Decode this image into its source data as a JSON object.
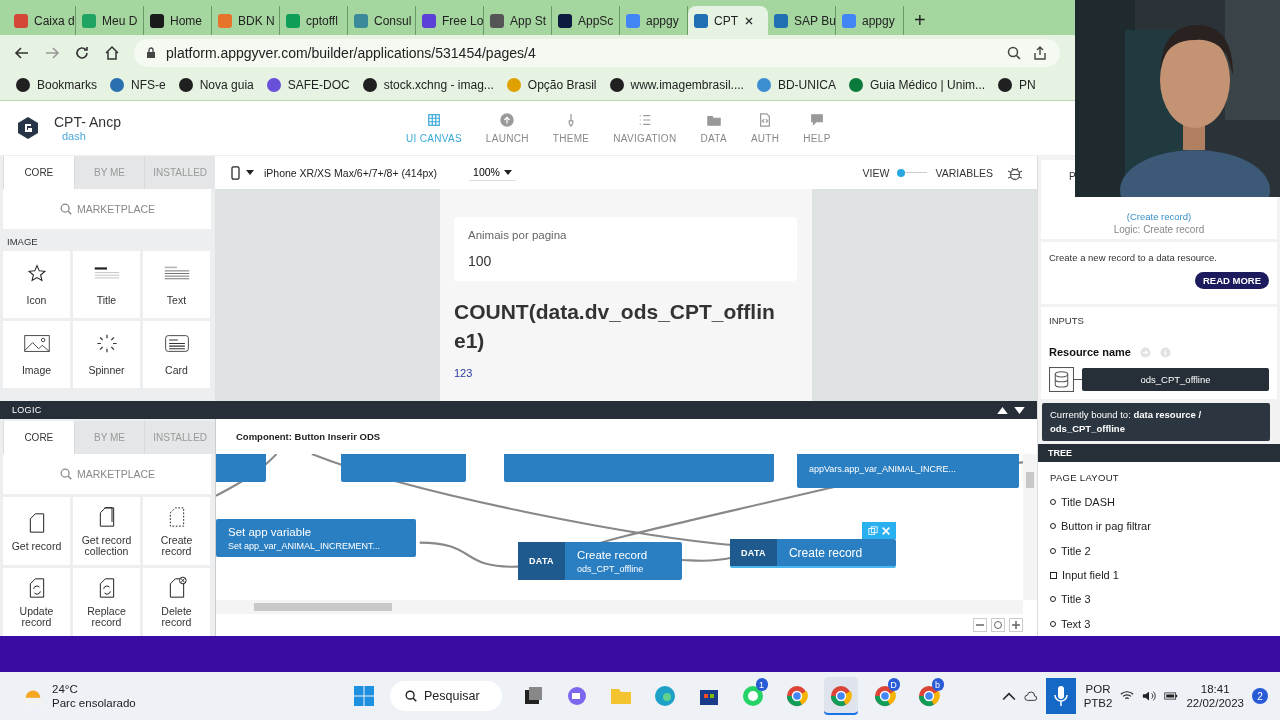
{
  "browser": {
    "tabs": [
      {
        "label": "Caixa d",
        "selected": false,
        "color": "#d44638"
      },
      {
        "label": "Meu D",
        "selected": false,
        "color": "#1fa463"
      },
      {
        "label": "Home",
        "selected": false,
        "color": "#1a1a1a"
      },
      {
        "label": "BDK N",
        "selected": false,
        "color": "#e8742a"
      },
      {
        "label": "cptoffl",
        "selected": false,
        "color": "#0f9d58"
      },
      {
        "label": "Consul",
        "selected": false,
        "color": "#3a8a9a"
      },
      {
        "label": "Free Lo",
        "selected": false,
        "color": "#5b3fd6"
      },
      {
        "label": "App St",
        "selected": false,
        "color": "#555555"
      },
      {
        "label": "AppSc",
        "selected": false,
        "color": "#0d1b3e"
      },
      {
        "label": "appgy",
        "selected": false,
        "color": "#4285f4"
      },
      {
        "label": "CPT",
        "selected": true,
        "color": "#1f6fb2"
      },
      {
        "label": "SAP Bu",
        "selected": false,
        "color": "#1f6fb2"
      },
      {
        "label": "appgy",
        "selected": false,
        "color": "#4285f4"
      }
    ],
    "new_tab": "+",
    "address": "platform.appgyver.com/builder/applications/531454/pages/4",
    "bookmarks": [
      {
        "label": "Bookmarks",
        "color": "#202020"
      },
      {
        "label": "NFS-e",
        "color": "#2a6fb0"
      },
      {
        "label": "Nova guia",
        "color": "#202020"
      },
      {
        "label": "SAFE-DOC",
        "color": "#6a4fd8"
      },
      {
        "label": "stock.xchng - imag...",
        "color": "#202020"
      },
      {
        "label": "Opção Brasil",
        "color": "#e0a000"
      },
      {
        "label": "www.imagembrasil....",
        "color": "#202020"
      },
      {
        "label": "BD-UNICA",
        "color": "#3b8fd0"
      },
      {
        "label": "Guia Médico | Unim...",
        "color": "#0a7a3a"
      },
      {
        "label": "PN",
        "color": "#202020"
      }
    ]
  },
  "app": {
    "title": "CPT- Ancp",
    "breadcrumb": "dash",
    "nav": [
      {
        "label": "UI CANVAS",
        "kind": "grid",
        "selected": true
      },
      {
        "label": "LAUNCH",
        "kind": "upload",
        "selected": false
      },
      {
        "label": "THEME",
        "kind": "brush",
        "selected": false
      },
      {
        "label": "NAVIGATION",
        "kind": "list",
        "selected": false
      },
      {
        "label": "DATA",
        "kind": "folder",
        "selected": false
      },
      {
        "label": "AUTH",
        "kind": "code",
        "selected": false
      },
      {
        "label": "HELP",
        "kind": "chat",
        "selected": false
      }
    ]
  },
  "palette": {
    "tabs": [
      {
        "label": "CORE",
        "selected": true
      },
      {
        "label": "BY ME",
        "selected": false
      },
      {
        "label": "INSTALLED",
        "selected": false
      }
    ],
    "search_placeholder": "MARKETPLACE",
    "section": "IMAGE",
    "items": [
      {
        "label": "Icon",
        "kind": "star"
      },
      {
        "label": "Title",
        "kind": "title"
      },
      {
        "label": "Text",
        "kind": "text"
      },
      {
        "label": "Image"
      },
      {
        "label": "Spinner",
        "kind": "spinner"
      },
      {
        "label": "Card",
        "kind": "card"
      }
    ]
  },
  "canvas": {
    "device": "iPhone XR/XS Max/6+/7+/8+ (414px)",
    "zoom": "100%",
    "view_label": "VIEW",
    "variables_label": "VARIABLES"
  },
  "preview": {
    "field_label": "Animais por pagina",
    "field_value": "100",
    "heading": "COUNT(data.dv_ods_CPT_offline1)",
    "number": "123"
  },
  "logic": {
    "title": "LOGIC",
    "palette": {
      "tabs": [
        {
          "label": "CORE",
          "selected": true
        },
        {
          "label": "BY ME",
          "selected": false
        },
        {
          "label": "INSTALLED",
          "selected": false
        }
      ],
      "search_placeholder": "MARKETPLACE",
      "items": [
        {
          "label": "Get record",
          "kind": "doc"
        },
        {
          "label": "Get record collection",
          "kind": "docs"
        },
        {
          "label": "Create record",
          "kind": "dashed"
        },
        {
          "label": "Update record",
          "kind": "refresh"
        },
        {
          "label": "Replace record",
          "kind": "refresh"
        },
        {
          "label": "Delete record",
          "kind": "delete"
        }
      ]
    },
    "component": "Component: Button Inserir ODS",
    "nodes": [
      {
        "kind": "stub",
        "selected": false
      },
      {
        "kind": "stub",
        "selected": false
      },
      {
        "kind": "stub",
        "selected": false
      },
      {
        "kind": "plain",
        "subtitle": "appVars.app_var_ANIMAL_INCRE...",
        "selected": false
      },
      {
        "kind": "plain",
        "title": "Set app variable",
        "subtitle": "Set app_var_ANIMAL_INCREMENT...",
        "selected": false
      },
      {
        "kind": "tagged",
        "category": "DATA",
        "title": "Create record",
        "subtitle": "ods_CPT_offline",
        "selected": false
      },
      {
        "kind": "tagged",
        "category": "DATA",
        "title": "Create record",
        "selected": true
      }
    ]
  },
  "properties": {
    "tab": "P",
    "link": "(Create record)",
    "subtitle": "Logic: Create record",
    "description": "Create a new record to a data resource.",
    "read_more": "READ MORE",
    "inputs_title": "INPUTS",
    "resource_label": "Resource name",
    "resource_value": "ods_CPT_offline",
    "tooltip": "Currently bound to: **data resource / ods_CPT_offline**"
  },
  "tree": {
    "title": "TREE",
    "section": "PAGE LAYOUT",
    "items": [
      {
        "label": "Title DASH",
        "kind": "circle"
      },
      {
        "label": "Button ir pag filtrar",
        "kind": "circle"
      },
      {
        "label": "Title 2",
        "kind": "circle"
      },
      {
        "label": "Input field 1",
        "kind": "square"
      },
      {
        "label": "Title 3",
        "kind": "circle"
      },
      {
        "label": "Text 3",
        "kind": "circle"
      }
    ]
  },
  "taskbar": {
    "temperature": "24°C",
    "weather": "Parc ensolarado",
    "search": "Pesquisar",
    "apps": [
      {
        "kind": "square",
        "selected": false
      },
      {
        "kind": "chat",
        "selected": false
      },
      {
        "kind": "folder",
        "selected": false
      },
      {
        "kind": "edge",
        "selected": false
      },
      {
        "kind": "store",
        "selected": false
      },
      {
        "kind": "whatsapp",
        "badge": "1",
        "selected": false
      },
      {
        "kind": "chrome",
        "selected": false
      },
      {
        "kind": "chrome",
        "selected": true
      },
      {
        "kind": "chrome",
        "badge": "D",
        "selected": false
      },
      {
        "kind": "chrome",
        "badge": "b",
        "selected": false
      }
    ],
    "language": "POR",
    "layout": "PTB2",
    "time": "18:41",
    "date": "22/02/2023",
    "notifications": "2"
  }
}
